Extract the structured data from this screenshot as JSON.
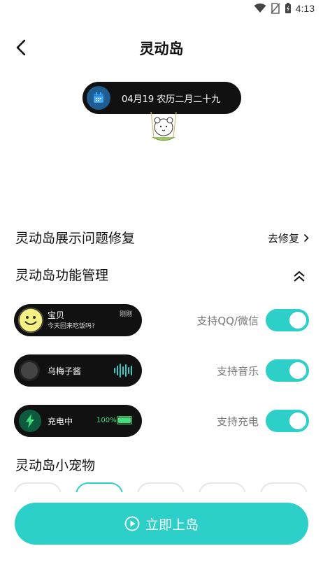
{
  "status_bar": {
    "time": "4:13"
  },
  "header": {
    "title": "灵动岛"
  },
  "preview": {
    "date_text": "04月19 农历二月二十九"
  },
  "repair": {
    "title": "灵动岛展示问题修复",
    "link_label": "去修复"
  },
  "manage": {
    "title": "灵动岛功能管理"
  },
  "features": {
    "chat": {
      "name": "宝贝",
      "message": "今天回来吃饭吗?",
      "time": "刚刚",
      "label": "支持QQ/微信",
      "enabled": true
    },
    "music": {
      "title": "乌梅子酱",
      "label": "支持音乐",
      "enabled": true
    },
    "charge": {
      "status": "充电中",
      "percent": "100%",
      "battery_level": 1.0,
      "label": "支持充电",
      "enabled": true
    }
  },
  "pets": {
    "title": "灵动岛小宠物",
    "card_count": 5,
    "selected_index": 1
  },
  "cta": {
    "label": "立即上岛"
  },
  "colors": {
    "accent": "#2cd0c9",
    "island": "#111111",
    "battery": "#3ee07a"
  }
}
